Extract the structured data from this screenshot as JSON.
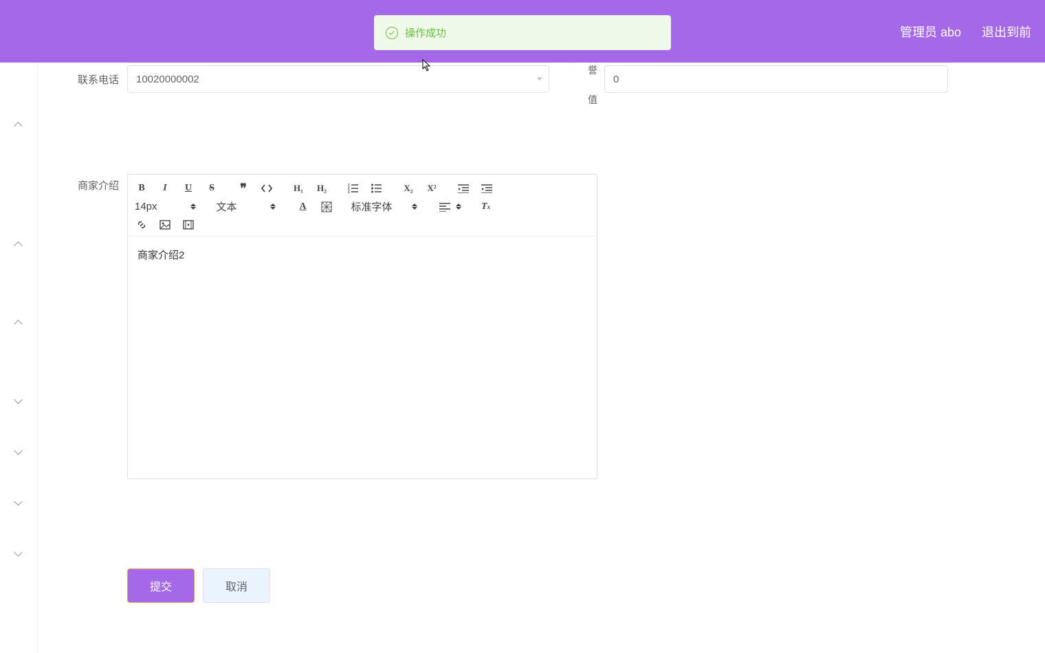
{
  "header": {
    "admin_label": "管理员 abo",
    "logout_label": "退出到前"
  },
  "toast": {
    "message": "操作成功"
  },
  "form": {
    "phone_label": "联系电话",
    "phone_value": "10020000002",
    "credit_label": "商家信誉",
    "credit_suffix": "值",
    "credit_value": "0",
    "intro_label": "商家介绍"
  },
  "editor": {
    "font_size": "14px",
    "text_type": "文本",
    "font_family": "标准字体",
    "content": "商家介绍2"
  },
  "buttons": {
    "submit": "提交",
    "cancel": "取消"
  }
}
